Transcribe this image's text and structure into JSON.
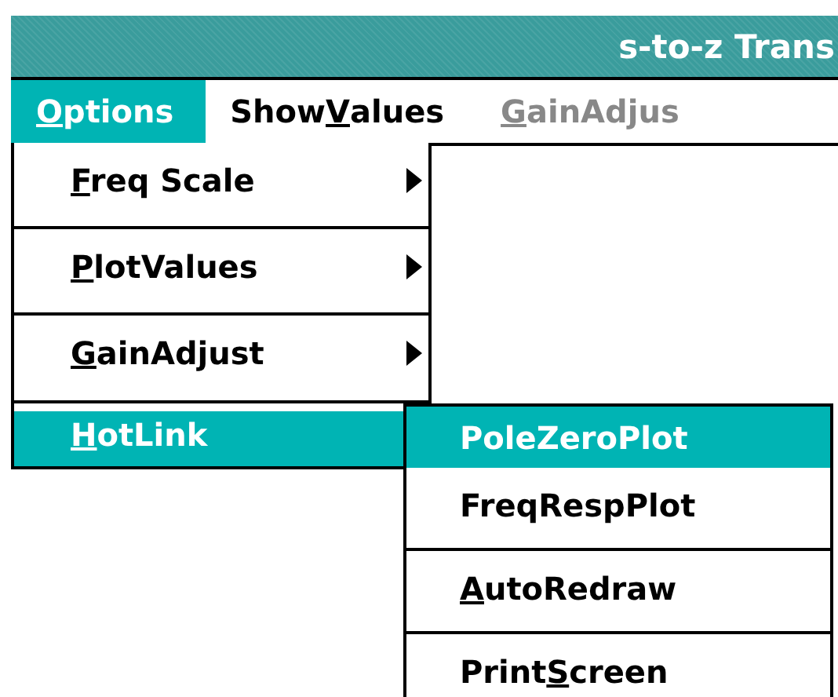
{
  "window": {
    "title": "s-to-z Trans"
  },
  "menu_bar": [
    {
      "label_parts": [
        {
          "text": "O",
          "underlined": true
        },
        {
          "text": "ptions",
          "underlined": false
        }
      ],
      "selected": true,
      "disabled": false
    },
    {
      "label_parts": [
        {
          "text": "Show",
          "underlined": false
        },
        {
          "text": "V",
          "underlined": true
        },
        {
          "text": "alues",
          "underlined": false
        }
      ],
      "selected": false,
      "disabled": false
    },
    {
      "label_parts": [
        {
          "text": "G",
          "underlined": true
        },
        {
          "text": "ainAdjus",
          "underlined": false
        }
      ],
      "selected": false,
      "disabled": true
    }
  ],
  "options_menu": [
    {
      "label_parts": [
        {
          "text": "F",
          "underlined": true
        },
        {
          "text": "req Scale",
          "underlined": false
        }
      ],
      "submenu": true,
      "selected": false,
      "separator_before": false
    },
    {
      "label_parts": [
        {
          "text": "P",
          "underlined": true
        },
        {
          "text": "lotValues",
          "underlined": false
        }
      ],
      "submenu": true,
      "selected": false,
      "separator_before": true
    },
    {
      "label_parts": [
        {
          "text": "G",
          "underlined": true
        },
        {
          "text": "ainAdjust",
          "underlined": false
        }
      ],
      "submenu": true,
      "selected": false,
      "separator_before": true
    },
    {
      "label_parts": [
        {
          "text": "H",
          "underlined": true
        },
        {
          "text": "otLink",
          "underlined": false
        }
      ],
      "selected": true,
      "separator_before": true
    }
  ],
  "hotlink_submenu": [
    {
      "label_parts": [
        {
          "text": "PoleZeroPlot",
          "underlined": false
        }
      ],
      "selected": true,
      "separator_before": false
    },
    {
      "label_parts": [
        {
          "text": "FreqRespPlot",
          "underlined": false
        }
      ],
      "selected": false,
      "separator_before": false
    },
    {
      "label_parts": [
        {
          "text": "A",
          "underlined": true
        },
        {
          "text": "utoRedraw",
          "underlined": false
        }
      ],
      "selected": false,
      "separator_before": true
    },
    {
      "label_parts": [
        {
          "text": "Print",
          "underlined": false
        },
        {
          "text": "S",
          "underlined": true
        },
        {
          "text": "creen",
          "underlined": false
        }
      ],
      "selected": false,
      "separator_before": true
    }
  ]
}
